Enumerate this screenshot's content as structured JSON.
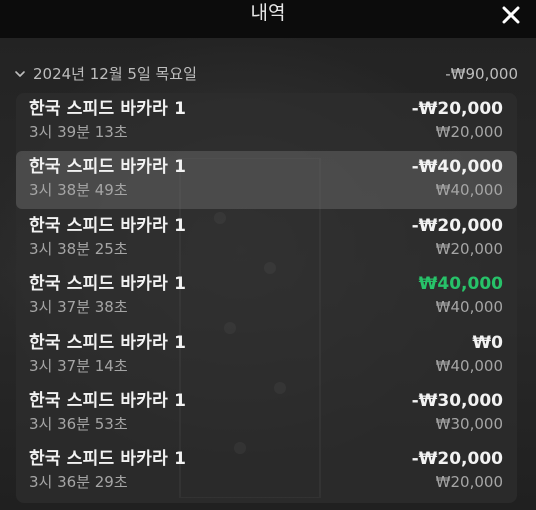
{
  "header": {
    "title": "내역"
  },
  "group": {
    "date": "2024년 12월 5일 목요일",
    "total": "-₩90,000"
  },
  "colors": {
    "win": "#27c269",
    "text": "#f2f2f2",
    "muted": "#a5a5a5"
  },
  "rows": [
    {
      "name": "한국 스피드 바카라 1",
      "time": "3시 39분 13초",
      "result": "-₩20,000",
      "bet": "₩20,000"
    },
    {
      "name": "한국 스피드 바카라 1",
      "time": "3시 38분 49초",
      "result": "-₩40,000",
      "bet": "₩40,000"
    },
    {
      "name": "한국 스피드 바카라 1",
      "time": "3시 38분 25초",
      "result": "-₩20,000",
      "bet": "₩20,000"
    },
    {
      "name": "한국 스피드 바카라 1",
      "time": "3시 37분 38초",
      "result": "₩40,000",
      "bet": "₩40,000"
    },
    {
      "name": "한국 스피드 바카라 1",
      "time": "3시 37분 14초",
      "result": "₩0",
      "bet": "₩40,000"
    },
    {
      "name": "한국 스피드 바카라 1",
      "time": "3시 36분 53초",
      "result": "-₩30,000",
      "bet": "₩30,000"
    },
    {
      "name": "한국 스피드 바카라 1",
      "time": "3시 36분 29초",
      "result": "-₩20,000",
      "bet": "₩20,000"
    }
  ]
}
